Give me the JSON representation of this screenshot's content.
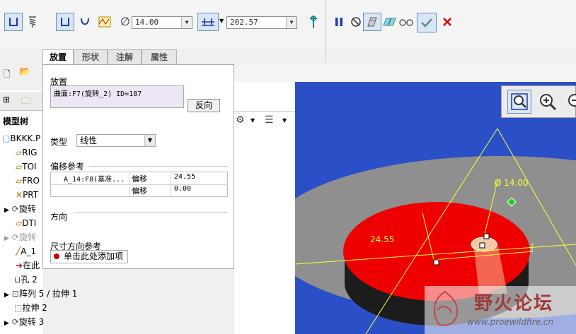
{
  "dashboard": {
    "diameter_value": "14.00",
    "depth_value": "202.57"
  },
  "tabs": [
    {
      "label": "放置",
      "active": true
    },
    {
      "label": "形状",
      "active": false
    },
    {
      "label": "注解",
      "active": false
    },
    {
      "label": "属性",
      "active": false
    }
  ],
  "placement": {
    "section_label": "放置",
    "surface_text": "曲面:F7(旋转_2) ID=187",
    "flip_button": "反向",
    "type_label": "类型",
    "type_value": "线性",
    "offset_refs_label": "偏移参考",
    "offset_rows": [
      {
        "ref": "A_14:F8(基准...",
        "kind": "偏移",
        "value": "24.55"
      },
      {
        "ref": "",
        "kind": "偏移",
        "value": "0.00"
      }
    ],
    "direction_label": "方向",
    "dim_ref_label": "尺寸方向参考",
    "add_item_text": "单击此处添加项"
  },
  "tree": {
    "header": "模型树",
    "items": [
      {
        "label": "BKKK.P"
      },
      {
        "label": "RIG"
      },
      {
        "label": "TOI"
      },
      {
        "label": "FRO"
      },
      {
        "label": "PRT"
      },
      {
        "label": "旋转"
      },
      {
        "label": "DTI"
      },
      {
        "label": "旋转"
      },
      {
        "label": "A_1"
      },
      {
        "label": "在此"
      },
      {
        "label": "孔 2"
      },
      {
        "label": "阵列 5 / 拉伸 1"
      },
      {
        "label": "拉伸 2"
      },
      {
        "label": "旋转 3"
      }
    ]
  },
  "viewport": {
    "dim_diameter": "Ø 14.00",
    "dim_offset": "24.55"
  },
  "watermark": {
    "title": "野火论坛",
    "url": "www.proewildfire.cn"
  },
  "colors": {
    "viewport_bg": "#2a4fc7",
    "disk_red": "#ee0000",
    "dimension_yellow": "#ffff33",
    "cancel_red": "#e00000"
  }
}
